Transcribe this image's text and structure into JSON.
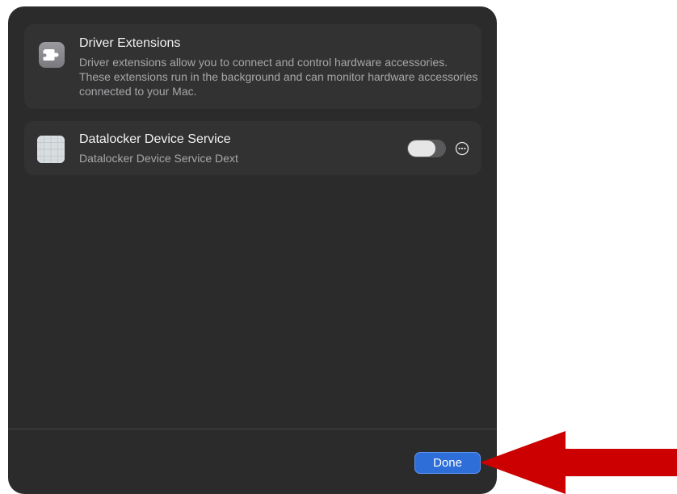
{
  "header": {
    "title": "Driver Extensions",
    "description": "Driver extensions allow you to connect and control hardware accessories. These extensions run in the background and can monitor hardware accessories connected to your Mac.",
    "icon": "puzzle-piece-icon"
  },
  "extensions": [
    {
      "name": "Datalocker Device Service",
      "subtitle": "Datalocker Device Service Dext",
      "enabled": false,
      "icon": "app-grid-icon"
    }
  ],
  "footer": {
    "done_label": "Done"
  },
  "colors": {
    "dialog_bg": "#2b2b2c",
    "card_bg": "#323233",
    "accent": "#2e6ed8",
    "annotation_arrow": "#cc0000"
  }
}
